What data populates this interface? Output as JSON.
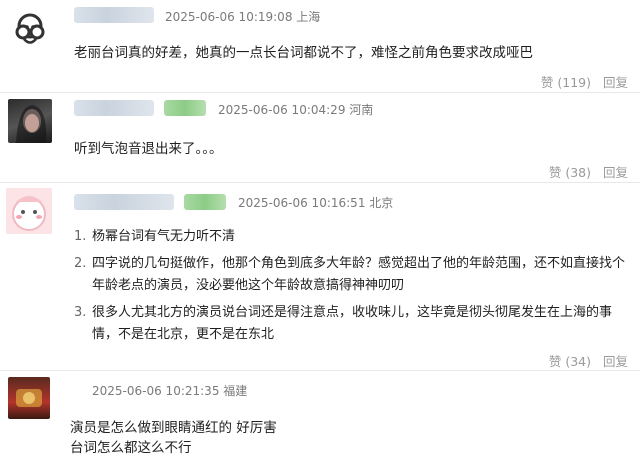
{
  "comments": [
    {
      "time": "2025-06-06 10:19:08",
      "location": "上海",
      "text": "老丽台词真的好差，她真的一点长台词都说不了，难怪之前角色要求改成哑巴",
      "like_label": "赞",
      "like_count": "(119)",
      "reply_label": "回复"
    },
    {
      "time": "2025-06-06 10:04:29",
      "location": "河南",
      "text": "听到气泡音退出来了。。。",
      "like_label": "赞",
      "like_count": "(38)",
      "reply_label": "回复"
    },
    {
      "time": "2025-06-06 10:16:51",
      "location": "北京",
      "items": [
        {
          "num": "1.",
          "lines": [
            "杨幂台词有气无力听不清"
          ]
        },
        {
          "num": "2.",
          "lines": [
            "四字说的几句挺做作，他那个角色到底多大年龄？感觉超出了他的年龄范围，还不如直接找个",
            "年龄老点的演员，没必要他这个年龄故意搞得神神叨叨"
          ]
        },
        {
          "num": "3.",
          "lines": [
            "很多人尤其北方的演员说台词还是得注意点，收收味儿，这毕竟是彻头彻尾发生在上海的事",
            "情，不是在北京，更不是在东北"
          ]
        }
      ],
      "like_label": "赞",
      "like_count": "(34)",
      "reply_label": "回复"
    },
    {
      "time": "2025-06-06 10:21:35",
      "location": "福建",
      "lines": [
        "演员是怎么做到眼睛通红的 好厉害",
        "台词怎么都这么不行"
      ]
    }
  ]
}
